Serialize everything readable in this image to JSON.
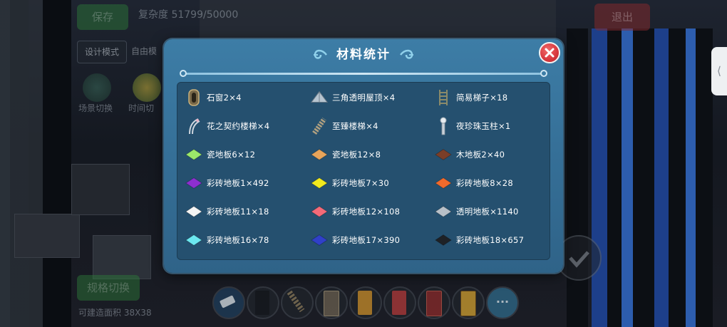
{
  "hud": {
    "save_label": "保存",
    "complexity_label": "复杂度 51799/50000",
    "exit_label": "退出",
    "design_mode_label": "设计模式",
    "free_mode_label": "自由模",
    "scene_switch_label": "场景切换",
    "time_switch_label": "时间切",
    "blueprint_switch_label": "规格切换",
    "area_label": "可建造面积 38X38",
    "side_tab_icon": "chevron-left-icon"
  },
  "dialog": {
    "title": "材料统计",
    "close_icon": "close-icon"
  },
  "materials": [
    {
      "label": "石窗2×4",
      "icon": "window-icon"
    },
    {
      "label": "三角透明屋顶×4",
      "icon": "roof-icon"
    },
    {
      "label": "简易梯子×18",
      "icon": "ladder-icon"
    },
    {
      "label": "花之契约楼梯×4",
      "icon": "flower-stair-icon"
    },
    {
      "label": "至臻楼梯×4",
      "icon": "stair-icon"
    },
    {
      "label": "夜珍珠玉柱×1",
      "icon": "pillar-icon"
    },
    {
      "label": "瓷地板6×12",
      "icon": "tile-icon",
      "color": "#9be86a"
    },
    {
      "label": "瓷地板12×8",
      "icon": "tile-icon",
      "color": "#e8a45a"
    },
    {
      "label": "木地板2×40",
      "icon": "tile-icon",
      "color": "#7a3e28"
    },
    {
      "label": "彩砖地板1×492",
      "icon": "tile-icon",
      "color": "#8e2fd0"
    },
    {
      "label": "彩砖地板7×30",
      "icon": "tile-icon",
      "color": "#f2ea1e"
    },
    {
      "label": "彩砖地板8×28",
      "icon": "tile-icon",
      "color": "#f06a2c"
    },
    {
      "label": "彩砖地板11×18",
      "icon": "tile-icon",
      "color": "#f4f4f4"
    },
    {
      "label": "彩砖地板12×108",
      "icon": "tile-icon",
      "color": "#f46a78"
    },
    {
      "label": "透明地板×1140",
      "icon": "tile-icon",
      "color": "#b8c0c8"
    },
    {
      "label": "彩砖地板16×78",
      "icon": "tile-icon",
      "color": "#6ce8f0"
    },
    {
      "label": "彩砖地板17×390",
      "icon": "tile-icon",
      "color": "#3040c8"
    },
    {
      "label": "彩砖地板18×657",
      "icon": "tile-icon",
      "color": "#1e2126"
    }
  ],
  "hotbar": [
    {
      "icon": "eraser-icon"
    },
    {
      "icon": "block-icon"
    },
    {
      "icon": "stair-icon"
    },
    {
      "icon": "door-icon"
    },
    {
      "icon": "door-icon"
    },
    {
      "icon": "door-icon"
    },
    {
      "icon": "door-icon"
    },
    {
      "icon": "door-icon"
    },
    {
      "icon": "more-icon",
      "label": "···"
    }
  ]
}
